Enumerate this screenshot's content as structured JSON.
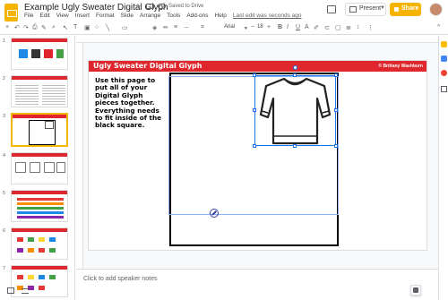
{
  "app": {
    "document_title": "Example Ugly Sweater Digital Glyph",
    "save_status": "Saved to Drive",
    "menu": [
      "File",
      "Edit",
      "View",
      "Insert",
      "Format",
      "Slide",
      "Arrange",
      "Tools",
      "Add-ons",
      "Help"
    ],
    "last_edit": "Last edit was seconds ago",
    "present_label": "Present",
    "share_label": "Share",
    "accent_color": "#f4b400"
  },
  "toolbar": {
    "font": "Arial",
    "font_size": "18"
  },
  "filmstrip": {
    "slides": [
      {
        "number": "1"
      },
      {
        "number": "2"
      },
      {
        "number": "3",
        "selected": true
      },
      {
        "number": "4"
      },
      {
        "number": "5"
      },
      {
        "number": "6"
      },
      {
        "number": "7"
      }
    ]
  },
  "slide": {
    "title": "Ugly Sweater Digital Glyph",
    "credit": "© Brittany Washburn",
    "instructions": "Use this page to put all of your Digital Glyph pieces together. Everything needs to fit inside of the black square.",
    "header_color": "#e0262d"
  },
  "notes": {
    "placeholder": "Click to add speaker notes"
  }
}
